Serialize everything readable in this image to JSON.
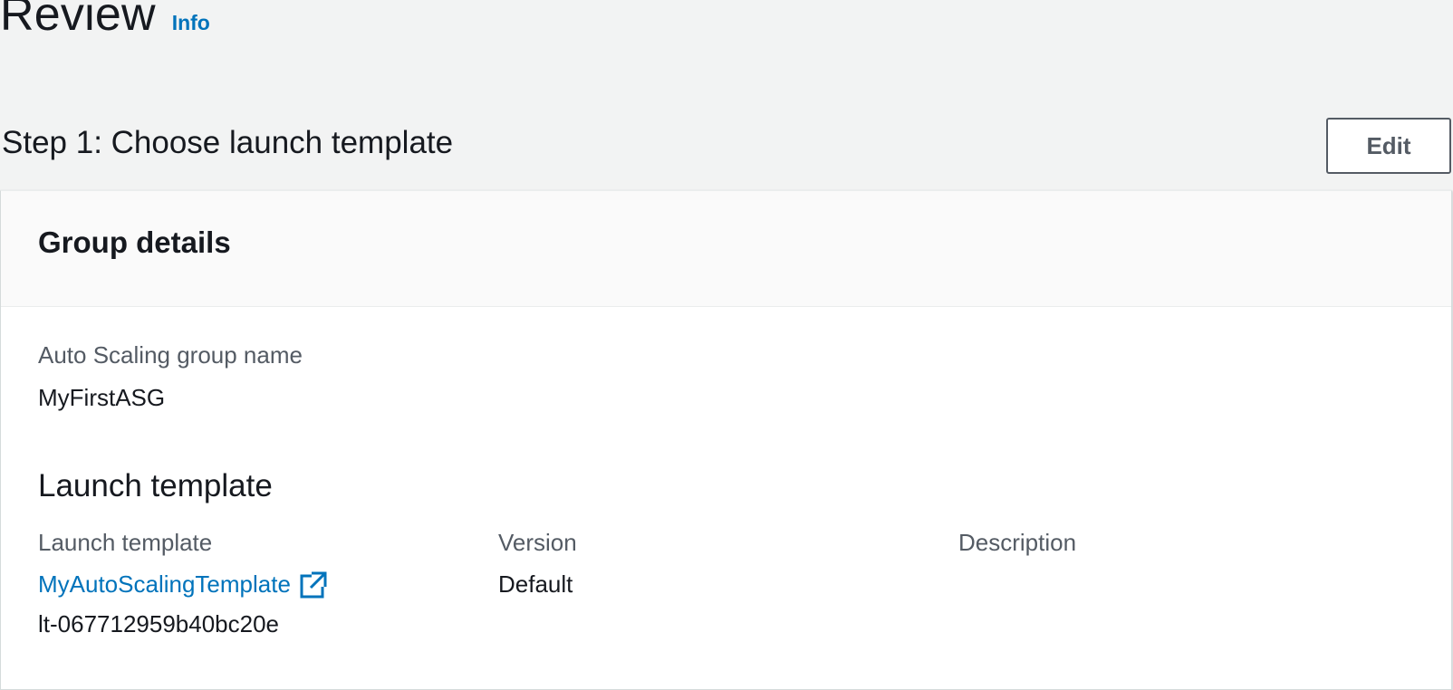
{
  "page": {
    "title": "Review",
    "info_link": "Info"
  },
  "step1": {
    "title": "Step 1: Choose launch template",
    "edit_label": "Edit"
  },
  "group_details": {
    "title": "Group details",
    "asg_name_label": "Auto Scaling group name",
    "asg_name_value": "MyFirstASG"
  },
  "launch_template": {
    "section_title": "Launch template",
    "columns": {
      "launch_template_label": "Launch template",
      "version_label": "Version",
      "description_label": "Description"
    },
    "template_name": "MyAutoScalingTemplate",
    "template_id": "lt-067712959b40bc20e",
    "version_value": "Default",
    "link_icon": "external-link-icon"
  },
  "colors": {
    "link": "#0073bb",
    "text": "#16191f",
    "label": "#545b64",
    "background": "#f2f3f3"
  }
}
